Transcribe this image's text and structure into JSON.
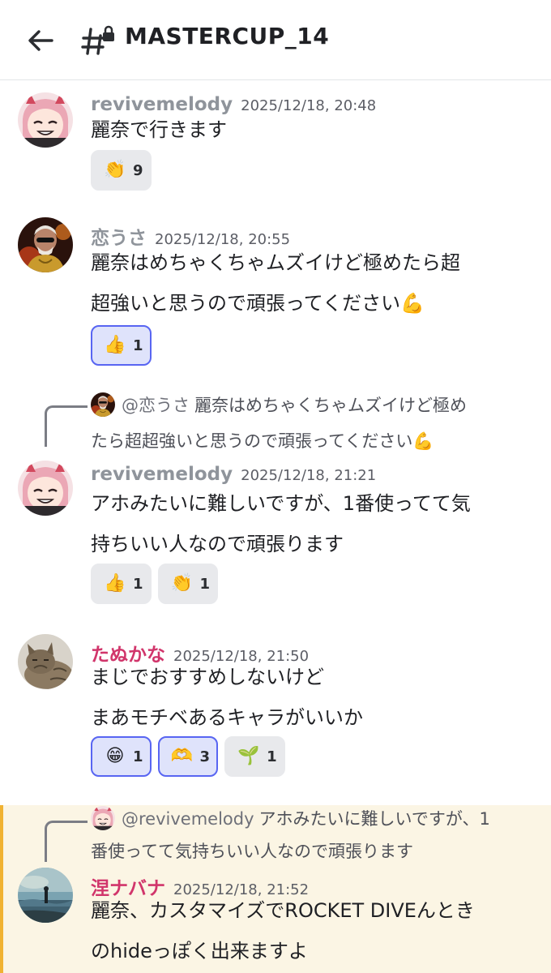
{
  "header": {
    "channel_name": "MASTERCUP_14",
    "back_icon": "arrow-left-icon",
    "channel_icon": "locked-hash-icon"
  },
  "colors": {
    "accent_reaction_border": "#5865f2",
    "highlight_bar": "#f0b232",
    "highlight_bg": "#fbf5e4",
    "tanukana_name": "#d1356b",
    "hanabana_name": "#d1356b",
    "revivemelody_name": "#8f949b",
    "koiusa_name": "#8f949b"
  },
  "messages": [
    {
      "username": "revivemelody",
      "timestamp": "2025/12/18, 20:48",
      "lines": [
        "麗奈で行きます"
      ],
      "reactions": [
        {
          "emoji": "👏",
          "count": "9",
          "me": false
        }
      ]
    },
    {
      "username": "恋うさ",
      "timestamp": "2025/12/18, 20:55",
      "lines": [
        "麗奈はめちゃくちゃムズイけど極めたら超",
        "超強いと思うので頑張ってください💪"
      ],
      "reactions": [
        {
          "emoji": "👍",
          "count": "1",
          "me": true
        }
      ]
    },
    {
      "reply": {
        "mention": "@恋うさ",
        "line1": "麗奈はめちゃくちゃムズイけど極め",
        "line2": "たら超超強いと思うので頑張ってください💪"
      },
      "username": "revivemelody",
      "timestamp": "2025/12/18, 21:21",
      "lines": [
        "アホみたいに難しいですが、1番使ってて気",
        "持ちいい人なので頑張ります"
      ],
      "reactions": [
        {
          "emoji": "👍",
          "count": "1",
          "me": false
        },
        {
          "emoji": "👏",
          "count": "1",
          "me": false
        }
      ]
    },
    {
      "username": "たぬかな",
      "timestamp": "2025/12/18, 21:50",
      "lines": [
        "まじでおすすめしないけど",
        "まあモチベあるキャラがいいか"
      ],
      "reactions": [
        {
          "emoji": "😁",
          "count": "1",
          "me": true
        },
        {
          "emoji": "🫶",
          "count": "3",
          "me": true
        },
        {
          "emoji": "🌱",
          "count": "1",
          "me": false
        }
      ]
    },
    {
      "reply": {
        "mention": "@revivemelody",
        "line1": "アホみたいに難しいですが、1",
        "line2": "番使ってて気持ちいい人なので頑張ります"
      },
      "username": "涅ナバナ",
      "timestamp": "2025/12/18, 21:52",
      "lines": [
        "麗奈、カスタマイズでROCKET DIVEんときの",
        "hideっぽく出来ますよ"
      ],
      "lines_display": [
        "麗奈、カスタマイズでROCKET DIVEんとき",
        "のhideっぽく出来ますよ"
      ]
    }
  ]
}
